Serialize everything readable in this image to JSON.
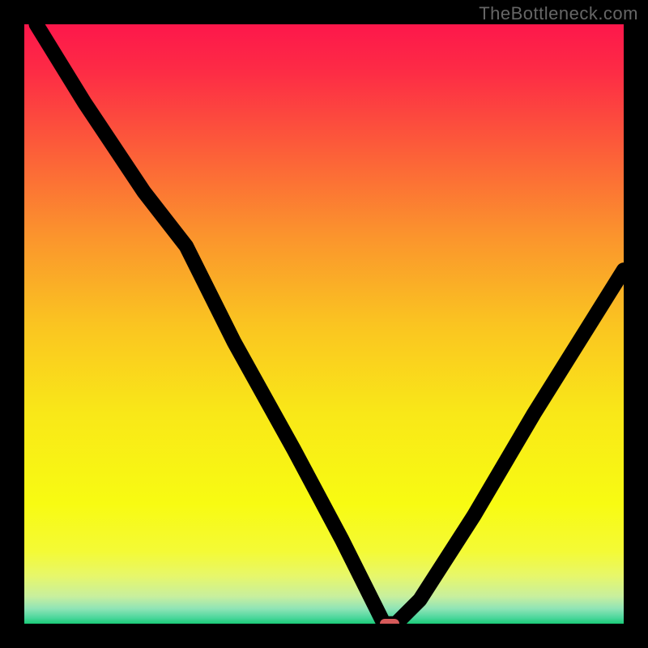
{
  "watermark": "TheBottleneck.com",
  "chart_data": {
    "type": "line",
    "title": "",
    "xlabel": "",
    "ylabel": "",
    "xlim": [
      0,
      100
    ],
    "ylim": [
      0,
      100
    ],
    "x": [
      2,
      10,
      20,
      27,
      35,
      45,
      53,
      58,
      60,
      62,
      66,
      75,
      85,
      95,
      100
    ],
    "values": [
      100,
      87,
      72,
      63,
      47,
      29,
      14,
      4,
      0,
      0,
      4,
      18,
      35,
      51,
      59
    ],
    "marker": {
      "x": 61,
      "y": 0,
      "color": "#d65a5a"
    },
    "gradient_stops": [
      {
        "pos": 0.0,
        "color": "#fd174b"
      },
      {
        "pos": 0.08,
        "color": "#fd2c45"
      },
      {
        "pos": 0.2,
        "color": "#fc5a3a"
      },
      {
        "pos": 0.35,
        "color": "#fb932d"
      },
      {
        "pos": 0.5,
        "color": "#fac421"
      },
      {
        "pos": 0.65,
        "color": "#f9e818"
      },
      {
        "pos": 0.8,
        "color": "#f8fb12"
      },
      {
        "pos": 0.88,
        "color": "#f4fa36"
      },
      {
        "pos": 0.92,
        "color": "#e7f76a"
      },
      {
        "pos": 0.955,
        "color": "#c7ef9f"
      },
      {
        "pos": 0.975,
        "color": "#8fe4b6"
      },
      {
        "pos": 0.99,
        "color": "#4cd79c"
      },
      {
        "pos": 1.0,
        "color": "#1acb78"
      }
    ]
  }
}
